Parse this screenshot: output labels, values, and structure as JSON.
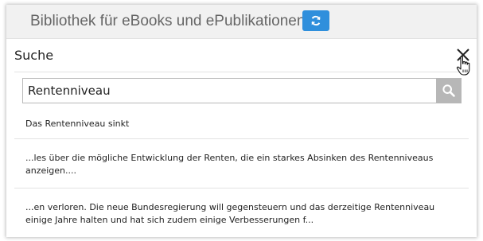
{
  "header": {
    "title": "Bibliothek für eBooks und ePublikationen",
    "refresh_icon": "refresh-icon",
    "accent": "#2f8fdc"
  },
  "panel": {
    "title": "Suche",
    "close_icon": "close-icon"
  },
  "search": {
    "value": "Rentenniveau",
    "search_icon": "search-icon"
  },
  "results": [
    {
      "text": "Das Rentenniveau sinkt"
    },
    {
      "text": "...les über die mögliche Entwicklung der Renten, die ein starkes Absinken des Rentenniveaus anzeigen...."
    },
    {
      "text": "...en verloren. Die neue Bundesregierung will gegensteuern und das derzeitige Rentenniveau einige Jahre halten und hat sich zudem einige Verbesserungen f..."
    }
  ]
}
